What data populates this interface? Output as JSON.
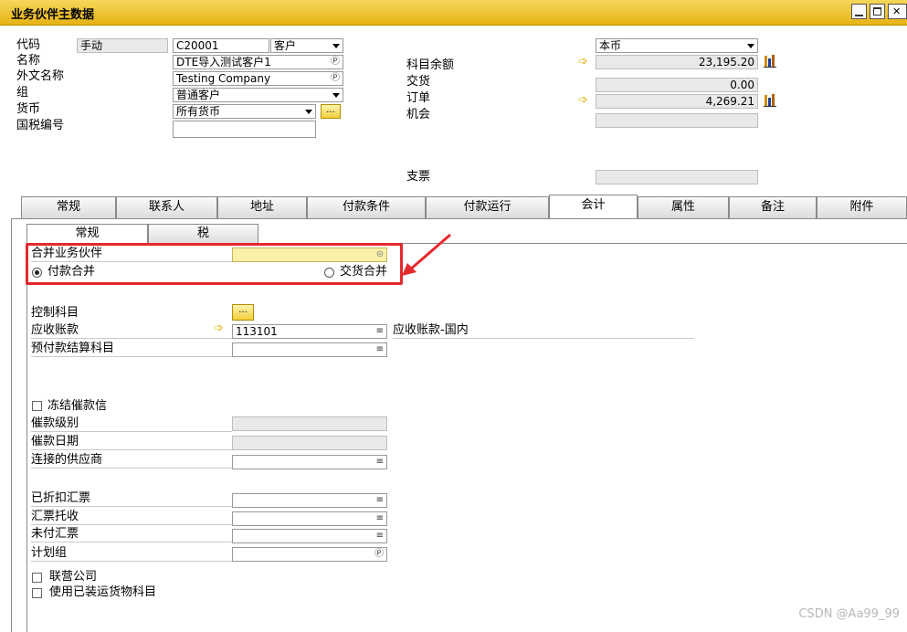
{
  "window": {
    "title": "业务伙伴主数据"
  },
  "header": {
    "code_label": "代码",
    "manual_label": "手动",
    "code_value": "C20001",
    "type_value": "客户",
    "name_label": "名称",
    "name_value": "DTE导入测试客户1",
    "foreign_name_label": "外文名称",
    "foreign_name_value": "Testing Company",
    "group_label": "组",
    "group_value": "普通客户",
    "currency_label": "货币",
    "currency_value": "所有货币",
    "tax_no_label": "国税编号",
    "tax_no_value": "",
    "local_currency_value": "本币",
    "account_balance_label": "科目余额",
    "account_balance_value": "23,195.20",
    "delivery_label": "交货",
    "delivery_value": "0.00",
    "order_label": "订单",
    "order_value": "4,269.21",
    "opportunity_label": "机会",
    "opportunity_value": "",
    "cheque_label": "支票",
    "cheque_value": "",
    "more_button": "..."
  },
  "tabs": [
    "常规",
    "联系人",
    "地址",
    "付款条件",
    "付款运行",
    "会计",
    "属性",
    "备注",
    "附件"
  ],
  "active_tab": "会计",
  "subtabs": [
    "常规",
    "税"
  ],
  "active_subtab": "常规",
  "accounting": {
    "consolidating_bp_label": "合并业务伙伴",
    "consolidating_bp_value": "",
    "payment_consolidation_label": "付款合并",
    "delivery_consolidation_label": "交货合并",
    "control_account_label": "控制科目",
    "control_account_button": "...",
    "receivable_label": "应收账款",
    "receivable_value": "113101",
    "receivable_desc": "应收账款-国内",
    "down_payment_label": "预付款结算科目",
    "down_payment_value": "",
    "freeze_dunning_label": "冻结催款信",
    "dunning_level_label": "催款级别",
    "dunning_date_label": "催款日期",
    "connected_vendor_label": "连接的供应商",
    "discounted_label": "已折扣汇票",
    "collection_label": "汇票托收",
    "unpaid_label": "未付汇票",
    "planning_group_label": "计划组",
    "affiliate_label": "联营公司",
    "use_shipped_label": "使用已装运货物科目"
  },
  "watermark": "CSDN @Aa99_99"
}
